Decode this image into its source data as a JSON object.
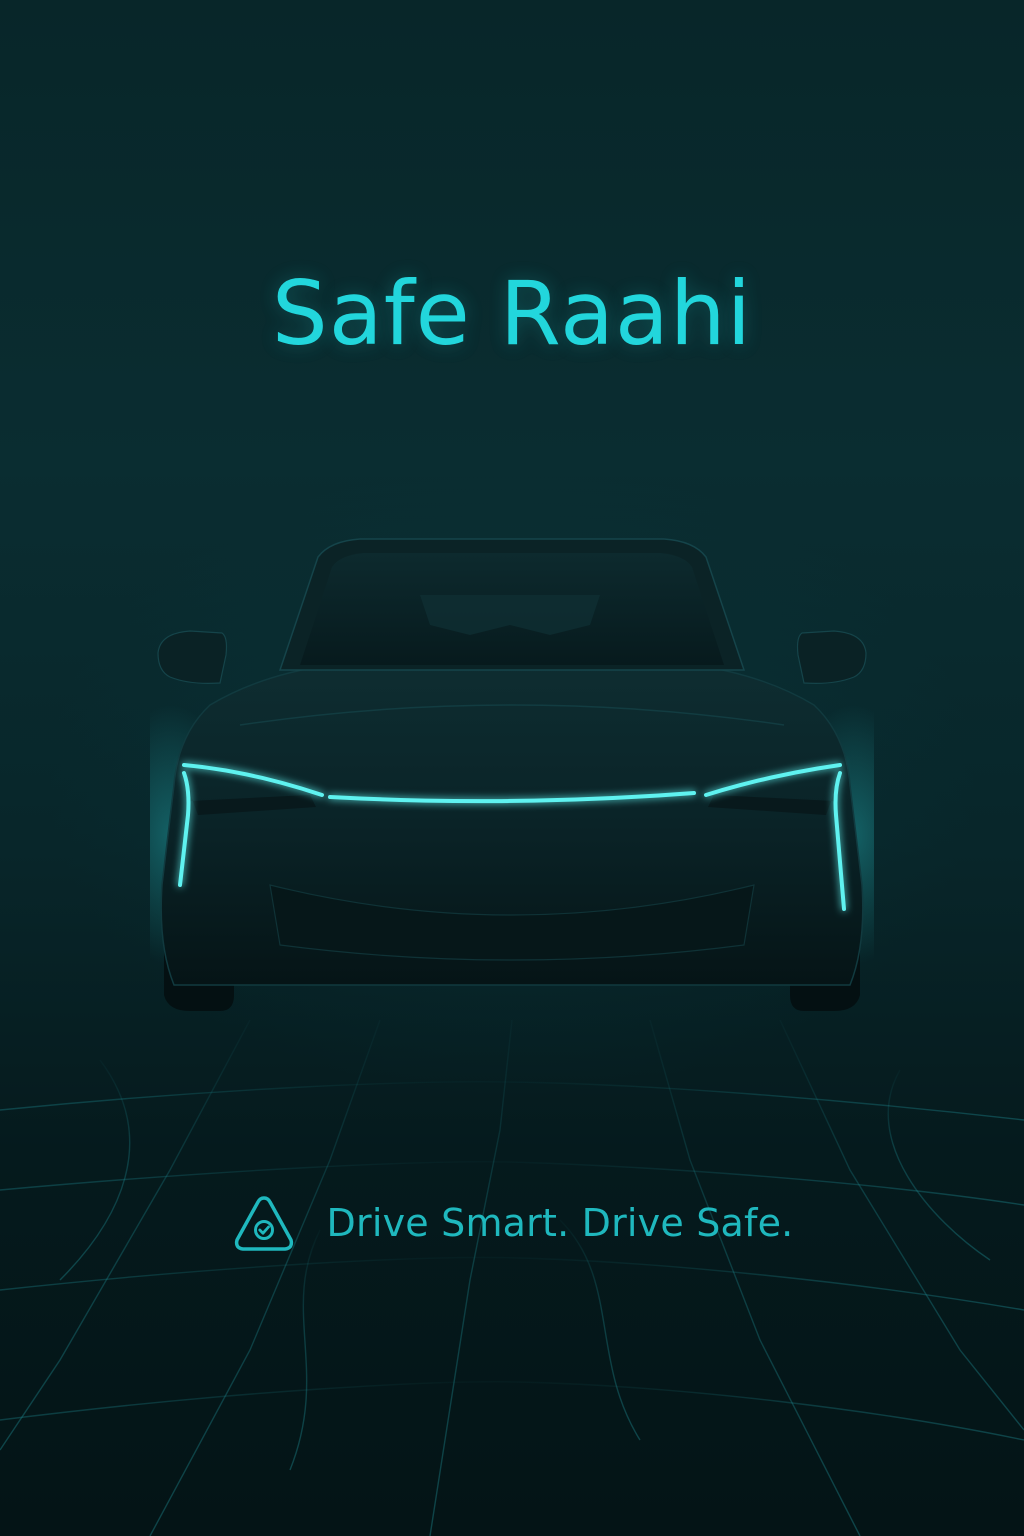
{
  "app": {
    "title": "Safe Raahi",
    "tagline": "Drive Smart. Drive Safe."
  },
  "icons": {
    "tagline_icon": "shield-check-icon",
    "hero_image": "electric-car-front-illustration"
  },
  "colors": {
    "accent": "#22d6dc",
    "tagline": "#1fb8be",
    "background": "#082629",
    "light_strip": "#5ef2f0"
  }
}
